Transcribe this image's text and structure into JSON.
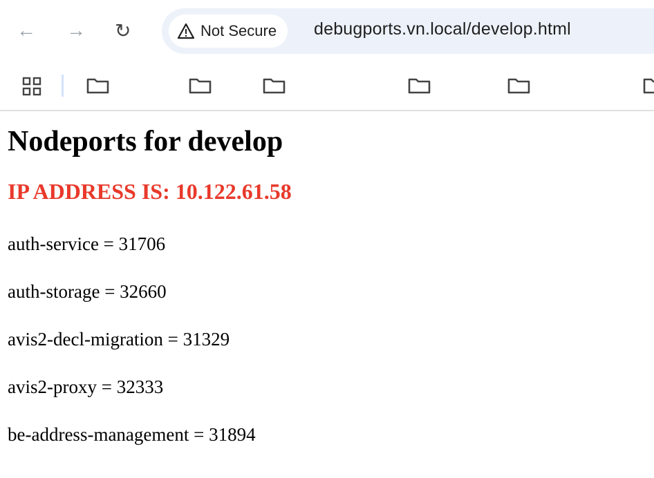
{
  "browser": {
    "security_label": "Not Secure",
    "url": "debugports.vn.local/develop.html",
    "icons": [
      "back-arrow-icon",
      "forward-arrow-icon",
      "reload-icon",
      "warning-icon",
      "apps-grid-icon",
      "folder-icon"
    ],
    "bookmark_folder_count_visible": 6
  },
  "page": {
    "title": "Nodeports for develop",
    "ip_heading": "IP ADDRESS IS: 10.122.61.58",
    "ip_color": "#e8392b",
    "entries": [
      {
        "text": "auth-service = 31706"
      },
      {
        "text": "auth-storage = 32660"
      },
      {
        "text": "avis2-decl-migration = 31329"
      },
      {
        "text": "avis2-proxy = 32333"
      },
      {
        "text": "be-address-management = 31894"
      }
    ]
  }
}
